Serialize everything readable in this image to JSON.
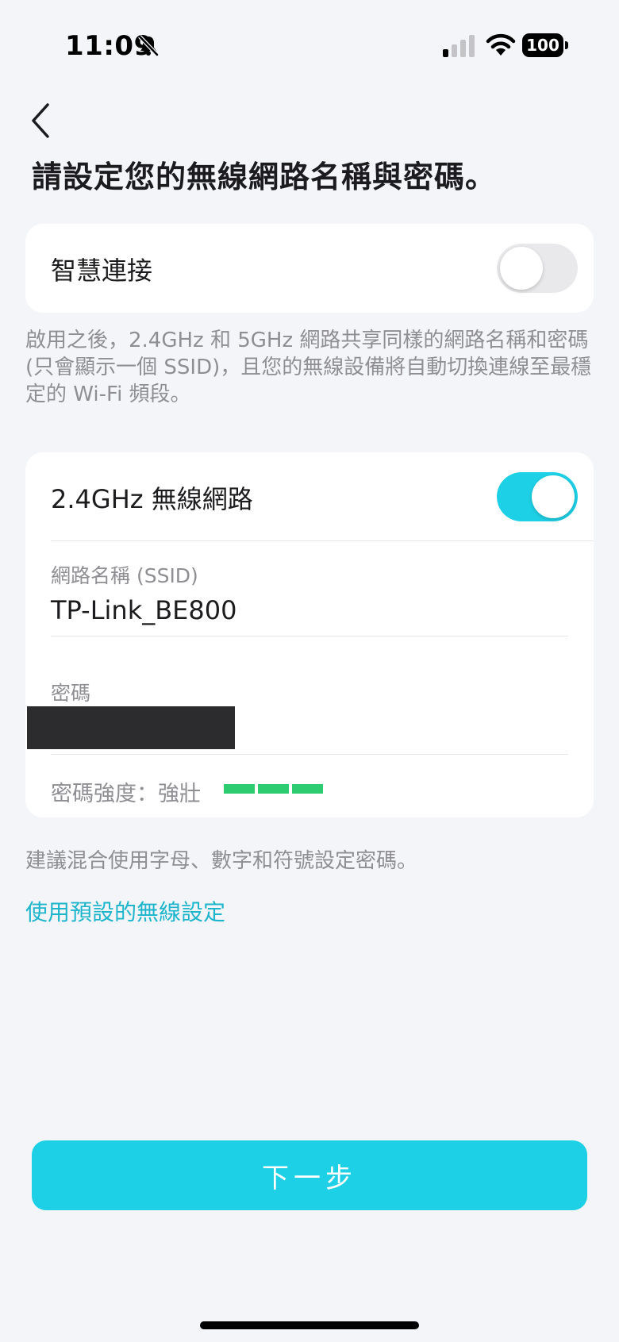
{
  "status_bar": {
    "time": "11:09",
    "battery": "100"
  },
  "page": {
    "title": "請設定您的無線網路名稱與密碼。"
  },
  "smart_connect": {
    "label": "智慧連接",
    "enabled": false,
    "description": "啟用之後，2.4GHz 和 5GHz 網路共享同樣的網路名稱和密碼 (只會顯示一個 SSID)，且您的無線設備將自動切換連線至最穩定的 Wi-Fi 頻段。"
  },
  "network_24": {
    "label": "2.4GHz 無線網路",
    "enabled": true,
    "ssid_label": "網路名稱 (SSID)",
    "ssid_value": "TP-Link_BE800",
    "password_label": "密碼",
    "strength_label": "密碼強度：強壯",
    "strength_level": 3
  },
  "hint": "建議混合使用字母、數字和符號設定密碼。",
  "link_default": "使用預設的無線設定",
  "next_button": "下一步",
  "colors": {
    "accent": "#1ED0E6",
    "link": "#1DB5CC",
    "strength": "#2ECC71"
  },
  "icons": {
    "back": "chevron-left-icon",
    "bell": "bell-slash-icon",
    "signal": "cellular-signal-icon",
    "wifi": "wifi-icon",
    "battery": "battery-icon"
  }
}
